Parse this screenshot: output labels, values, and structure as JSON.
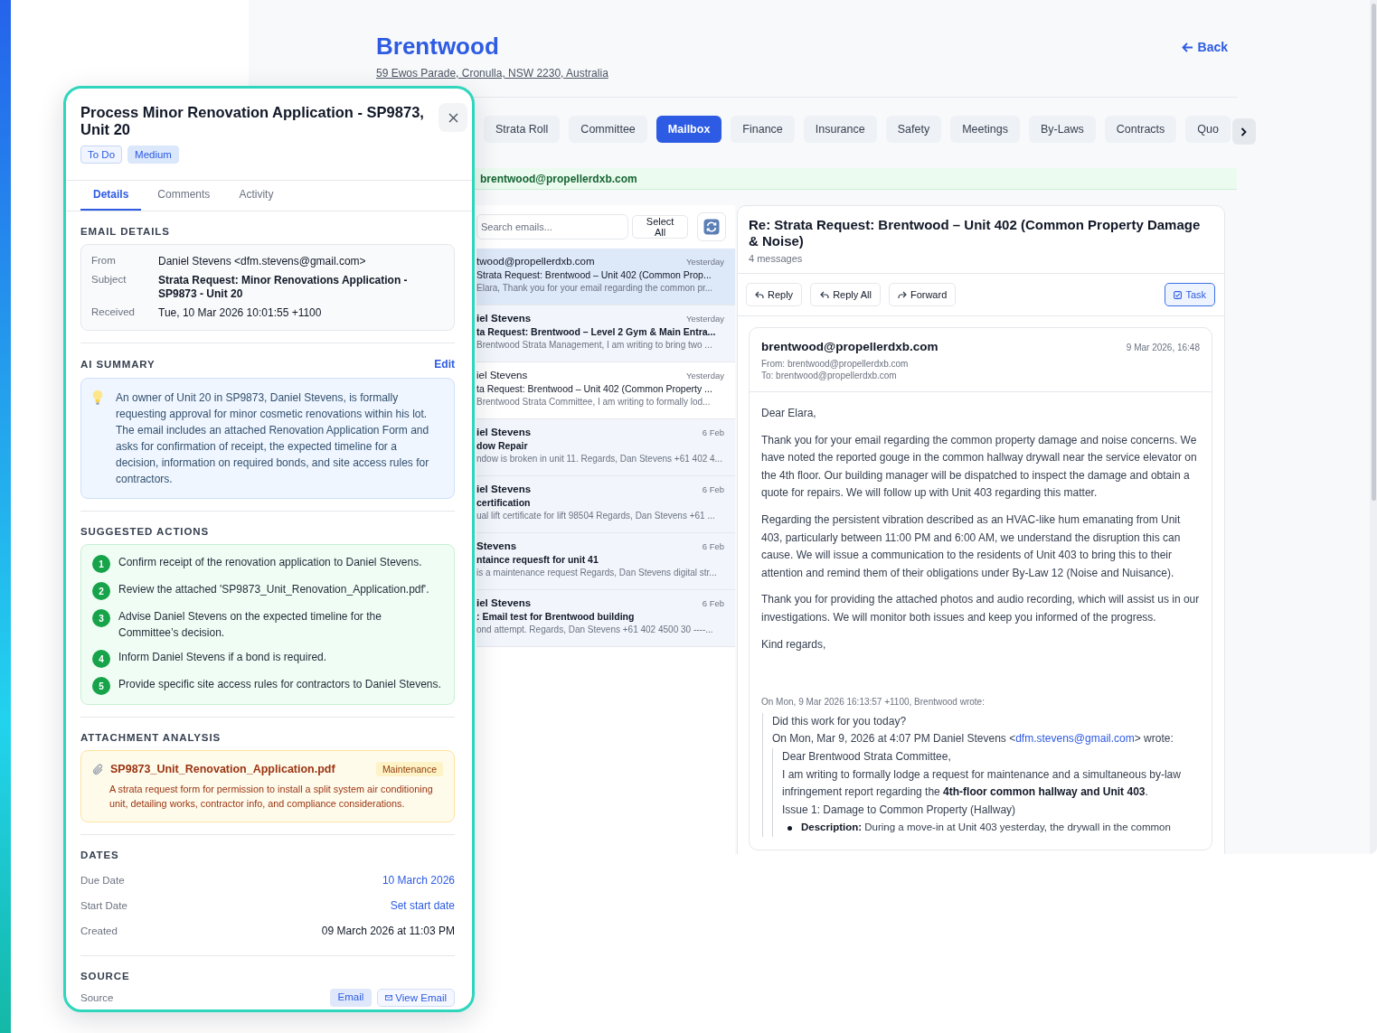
{
  "page": {
    "title": "Brentwood",
    "address": "59 Ewos Parade, Cronulla, NSW 2230, Australia",
    "back": "Back"
  },
  "tabs": [
    {
      "label": "Strata Roll",
      "selected": false
    },
    {
      "label": "Committee",
      "selected": false
    },
    {
      "label": "Mailbox",
      "selected": true
    },
    {
      "label": "Finance",
      "selected": false
    },
    {
      "label": "Insurance",
      "selected": false
    },
    {
      "label": "Safety",
      "selected": false
    },
    {
      "label": "Meetings",
      "selected": false
    },
    {
      "label": "By-Laws",
      "selected": false
    },
    {
      "label": "Contracts",
      "selected": false
    },
    {
      "label": "Quo",
      "selected": false
    }
  ],
  "mailbox": {
    "address": "brentwood@propellerdxb.com",
    "search": {
      "placeholder": "Search emails..."
    },
    "select_all": "Select All",
    "emails": [
      {
        "sender": "twood@propellerdxb.com",
        "date": "Yesterday",
        "subject": "Strata Request: Brentwood – Unit 402 (Common Prop...",
        "preview": "Elara, Thank you for your email regarding the common pr...",
        "selected": true,
        "unread": false
      },
      {
        "sender": "iel Stevens",
        "date": "Yesterday",
        "subject": "ta Request: Brentwood – Level 2 Gym & Main Entra...",
        "preview": "Brentwood Strata Management, I am writing to bring two ...",
        "selected": false,
        "unread": true
      },
      {
        "sender": "iel Stevens",
        "date": "Yesterday",
        "subject": "ta Request: Brentwood – Unit 402 (Common Property ...",
        "preview": "Brentwood Strata Committee, I am writing to formally lod...",
        "selected": false,
        "unread": false
      },
      {
        "sender": "iel Stevens",
        "date": "6 Feb",
        "subject": "dow Repair",
        "preview": "ndow is broken in unit 11. Regards, Dan Stevens +61 402 4...",
        "selected": false,
        "unread": true
      },
      {
        "sender": "iel Stevens",
        "date": "6 Feb",
        "subject": "certification",
        "preview": "ual lift certificate for lift 98504 Regards, Dan Stevens +61 ...",
        "selected": false,
        "unread": true
      },
      {
        "sender": "Stevens",
        "date": "6 Feb",
        "subject": "ntaince requesft for unit 41",
        "preview": "is a maintenance request Regards, Dan Stevens digital str...",
        "selected": false,
        "unread": true
      },
      {
        "sender": "iel Stevens",
        "date": "6 Feb",
        "subject": ": Email test for Brentwood building",
        "preview": "ond attempt. Regards, Dan Stevens +61 402 4500 30 ----...",
        "selected": false,
        "unread": true
      }
    ]
  },
  "reader": {
    "subject": "Re: Strata Request: Brentwood – Unit 402 (Common Property Damage & Noise)",
    "count": "4 messages",
    "actions": [
      {
        "label": "Reply",
        "kind": "reply"
      },
      {
        "label": "Reply All",
        "kind": "reply-all"
      },
      {
        "label": "Forward",
        "kind": "forward"
      }
    ],
    "task": "Task",
    "message": {
      "sender": "brentwood@propellerdxb.com",
      "date": "9 Mar 2026, 16:48",
      "from": "From: brentwood@propellerdxb.com",
      "to": "To: brentwood@propellerdxb.com",
      "paragraphs": [
        "Dear Elara,",
        "Thank you for your email regarding the common property damage and noise concerns. We have noted the reported gouge in the common hallway drywall near the service elevator on the 4th floor. Our building manager will be dispatched to inspect the damage and obtain a quote for repairs. We will follow up with Unit 403 regarding this matter.",
        "Regarding the persistent vibration described as an HVAC-like hum emanating from Unit 403, particularly between 11:00 PM and 6:00 AM, we understand the disruption this can cause. We will issue a communication to the residents of Unit 403 to bring this to their attention and remind them of their obligations under By-Law 12 (Noise and Nuisance).",
        "Thank you for providing the attached photos and audio recording, which will assist us in our investigations. We will monitor both issues and keep you informed of the progress.",
        "Kind regards,"
      ],
      "quote_header": "On Mon, 9 Mar 2026 16:13:57 +1100, Brentwood wrote:",
      "quote": {
        "lines": [
          "Did this work for you today?"
        ],
        "attribution": {
          "before": "On Mon, Mar 9, 2026 at 4:07 PM Daniel Stevens <",
          "link": "dfm.stevens@gmail.com",
          "after": "> wrote:"
        },
        "nested": {
          "lines": [
            "Dear Brentwood Strata Committee,",
            "I am writing to formally lodge a request for maintenance and a simultaneous by-law infringement report regarding the **4th-floor common hallway and Unit 403**.",
            "Issue 1: Damage to Common Property (Hallway)"
          ],
          "bullets": [
            "**Description:** During a move-in at Unit 403 yesterday, the drywall in the common"
          ]
        }
      }
    }
  },
  "task": {
    "title": "Process Minor Renovation Application - SP9873, Unit 20",
    "badges": [
      {
        "label": "To Do",
        "kind": "status"
      },
      {
        "label": "Medium",
        "kind": "priority"
      }
    ],
    "tabs": [
      {
        "label": "Details",
        "selected": true
      },
      {
        "label": "Comments",
        "selected": false
      },
      {
        "label": "Activity",
        "selected": false
      }
    ],
    "email_details": {
      "heading": "EMAIL DETAILS",
      "rows": [
        {
          "label": "From",
          "value": "Daniel Stevens <dfm.stevens@gmail.com>",
          "kind": "plain"
        },
        {
          "label": "Subject",
          "value": "Strata Request: Minor Renovations Application - SP9873 - Unit 20",
          "kind": "strong"
        },
        {
          "label": "Received",
          "value": "Tue, 10 Mar 2026 10:01:55 +1100",
          "kind": "plain"
        }
      ]
    },
    "ai_summary": {
      "heading": "AI SUMMARY",
      "edit": "Edit",
      "text": "An owner of Unit 20 in SP9873, Daniel Stevens, is formally requesting approval for minor cosmetic renovations within his lot. The email includes an attached Renovation Application Form and asks for confirmation of receipt, the expected timeline for a decision, information on required bonds, and site access rules for contractors."
    },
    "suggested_actions": {
      "heading": "SUGGESTED ACTIONS",
      "items": [
        {
          "number": "1",
          "text": "Confirm receipt of the renovation application to Daniel Stevens."
        },
        {
          "number": "2",
          "text": "Review the attached 'SP9873_Unit_Renovation_Application.pdf'."
        },
        {
          "number": "3",
          "text": "Advise Daniel Stevens on the expected timeline for the Committee’s decision."
        },
        {
          "number": "4",
          "text": "Inform Daniel Stevens if a bond is required."
        },
        {
          "number": "5",
          "text": "Provide specific site access rules for contractors to Daniel Stevens."
        }
      ]
    },
    "attachment_analysis": {
      "heading": "ATTACHMENT ANALYSIS",
      "files": [
        {
          "name": "SP9873_Unit_Renovation_Application.pdf",
          "tag": "Maintenance",
          "description": "A strata request form for permission to install a split system air conditioning unit, detailing works, contractor info, and compliance considerations."
        }
      ]
    },
    "dates": {
      "heading": "DATES",
      "rows": [
        {
          "label": "Due Date",
          "value": "10 March 2026",
          "kind": "link"
        },
        {
          "label": "Start Date",
          "value": "Set start date",
          "kind": "link"
        },
        {
          "label": "Created",
          "value": "09 March 2026 at 11:03 PM",
          "kind": "text"
        }
      ]
    },
    "source": {
      "heading": "SOURCE",
      "label": "Source",
      "badge": "Email",
      "button": "View Email"
    }
  }
}
